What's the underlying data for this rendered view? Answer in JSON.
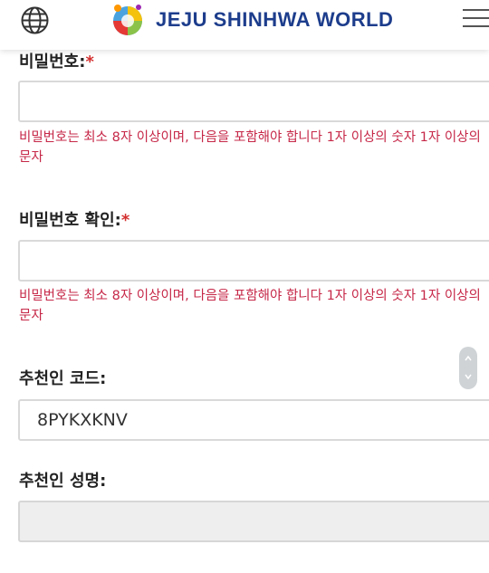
{
  "header": {
    "logo_text": "JEJU SHINHWA WORLD",
    "globe_icon": "globe-icon",
    "menu_icon": "hamburger-menu-icon"
  },
  "form": {
    "password_label": "비밀번호:",
    "password_value": "",
    "password_hint": "비밀번호는 최소 8자 이상이며, 다음을 포함해야 합니다 1자 이상의 숫자 1자 이상의 문자",
    "confirm_label": "비밀번호 확인:",
    "confirm_value": "",
    "confirm_hint": "비밀번호는 최소 8자 이상이며, 다음을 포함해야 합니다 1자 이상의 숫자 1자 이상의 문자",
    "referral_code_label": "추천인 코드:",
    "referral_code_value": "8PYKXKNV",
    "referrer_name_label": "추천인 성명:",
    "referrer_name_value": "",
    "required_mark": "*"
  },
  "colors": {
    "brand": "#1d3d8c",
    "required": "#d32f2f",
    "hint": "#c62848",
    "disabled_field": "#eeeeee"
  }
}
